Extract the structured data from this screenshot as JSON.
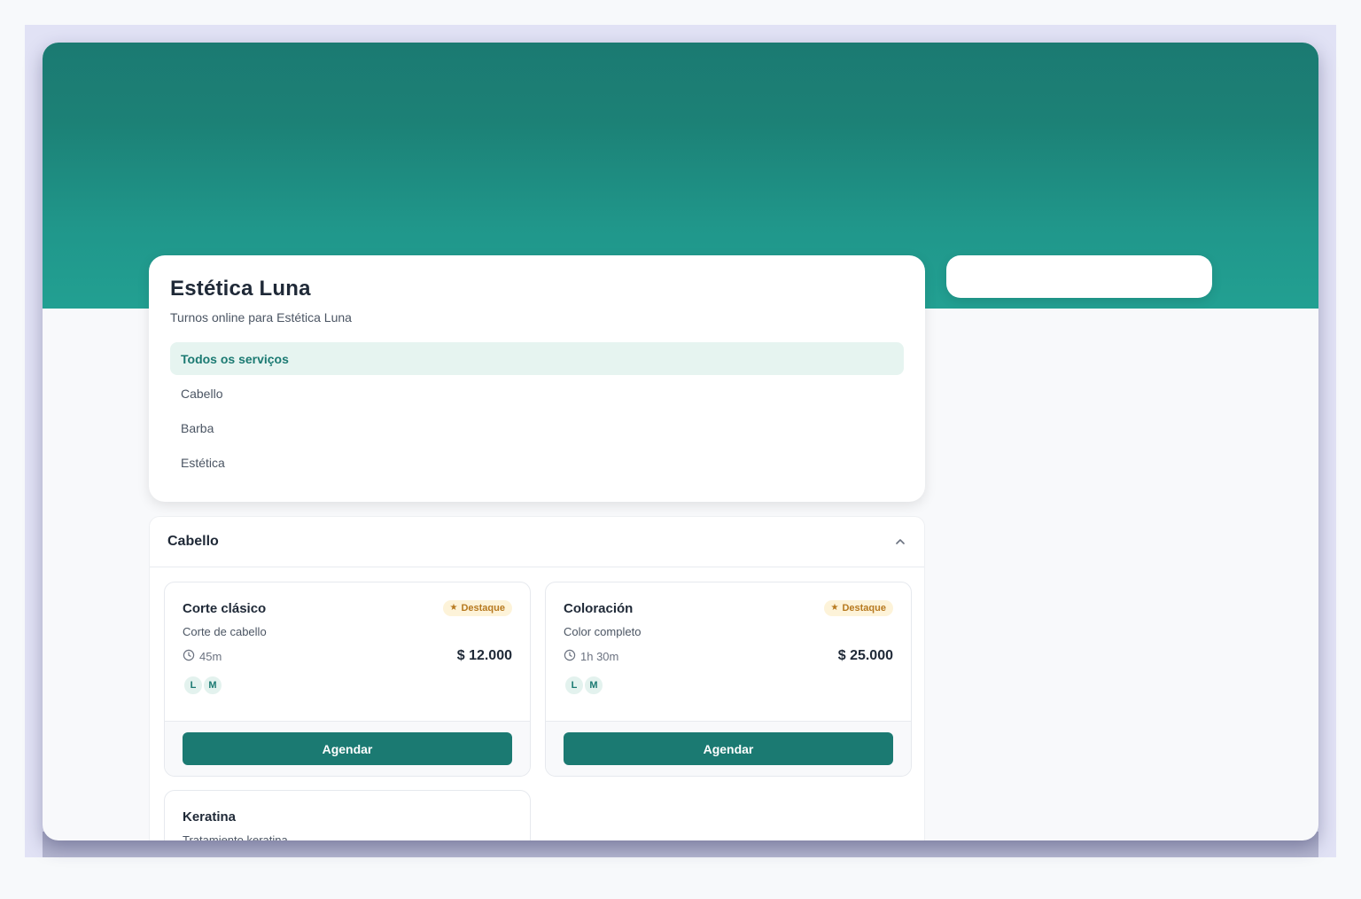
{
  "business": {
    "name": "Estética Luna",
    "subtitle": "Turnos online para Estética Luna"
  },
  "categories": [
    {
      "label": "Todos os serviços",
      "active": true
    },
    {
      "label": "Cabello",
      "active": false
    },
    {
      "label": "Barba",
      "active": false
    },
    {
      "label": "Estética",
      "active": false
    }
  ],
  "section": {
    "title": "Cabello",
    "chevron_icon": "chevron-up-icon",
    "services": [
      {
        "name": "Corte clásico",
        "badge": "Destaque",
        "description": "Corte de cabello",
        "duration": "45m",
        "price": "$ 12.000",
        "staff": [
          "L",
          "M"
        ],
        "button": "Agendar"
      },
      {
        "name": "Coloración",
        "badge": "Destaque",
        "description": "Color completo",
        "duration": "1h 30m",
        "price": "$ 25.000",
        "staff": [
          "L",
          "M"
        ],
        "button": "Agendar"
      },
      {
        "name": "Keratina",
        "description": "Tratamiento keratina"
      }
    ]
  },
  "colors": {
    "brand": "#1b7a72",
    "hero_top": "#1b7a72",
    "hero_bottom": "#22a092",
    "badge_bg": "#fdf3d9",
    "badge_text": "#b7791f",
    "active_bg": "#e6f4f0"
  }
}
